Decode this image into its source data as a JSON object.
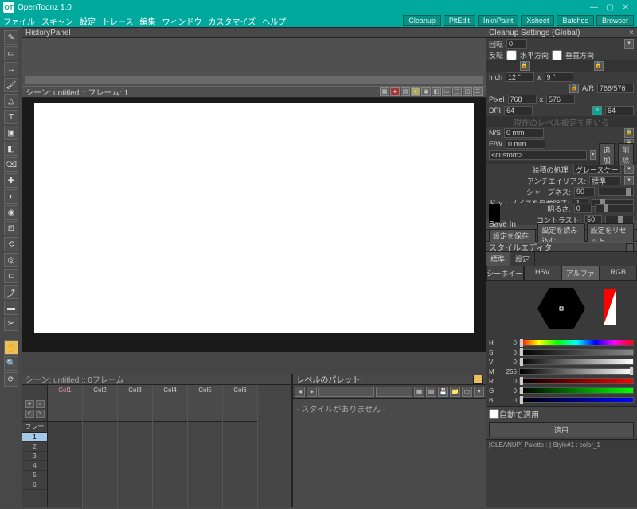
{
  "app": {
    "title": "OpenToonz 1.0",
    "logo": "OT"
  },
  "window_buttons": {
    "min": "—",
    "max": "▢",
    "close": "✕"
  },
  "menu": [
    "ファイル",
    "スキャン",
    "設定",
    "トレース",
    "編集",
    "ウィンドウ",
    "カスタマイズ",
    "ヘルプ"
  ],
  "modes": [
    "Cleanup",
    "PltEdit",
    "InknPaint",
    "Xsheet",
    "Batches",
    "Browser"
  ],
  "history_panel": {
    "title": "HistoryPanel"
  },
  "viewer": {
    "title": "シーン: untitled :: フレーム: 1"
  },
  "xsheet": {
    "title": "シーン: untitled   ::  0フレーム",
    "frame_label": "フレーム",
    "cols": [
      "Col1",
      "Col2",
      "Col3",
      "Col4",
      "Col5",
      "Col6"
    ],
    "frames": [
      "1",
      "2",
      "3",
      "4",
      "5",
      "6"
    ]
  },
  "palette": {
    "title": "レベルのパレット:",
    "empty_text": "- スタイルがありません -"
  },
  "cleanup": {
    "title": "Cleanup Settings (Global)",
    "rotation_label": "回転",
    "rotation_value": "0",
    "flip_label": "反転",
    "flip_h": "水平方向",
    "flip_v": "垂直方向",
    "inch_label": "Inch",
    "inch_w": "12 \"",
    "inch_h": "9 \"",
    "ar_label": "A/R",
    "ar_value": "768/576",
    "pixel_label": "Pixel",
    "pixel_w": "768",
    "pixel_h": "576",
    "dpi_label": "DPI",
    "dpi_value": "64",
    "dpi_value2": "64",
    "ns_label": "N/S",
    "ns_value": "0 mm",
    "ew_label": "E/W",
    "ew_value": "0 mm",
    "custom": "<custom>",
    "add": "追加",
    "remove": "削除",
    "line_label": "絵積の処理:",
    "line_value": "グレースケール",
    "anti_label": "アンチエイリアス:",
    "anti_value": "標準",
    "sharp_label": "シャープネス:",
    "sharp_value": "90",
    "dot_label": "ドットノイズを自動除去:",
    "dot_value": "2",
    "bright_label": "明るさ:",
    "bright_value": "0",
    "contrast_label": "コントラスト:",
    "contrast_value": "50",
    "savein_label": "Save In",
    "btn_save": "設定を保存",
    "btn_load": "設定を読み込む",
    "btn_reset": "設定をリセット"
  },
  "styleed": {
    "title": "スタイルエディタ",
    "tabs": [
      "標準",
      "設定"
    ],
    "modes": [
      "シーホイー",
      "HSV",
      "アルファ",
      "RGB"
    ],
    "channels": [
      {
        "l": "H",
        "v": "0"
      },
      {
        "l": "S",
        "v": "0"
      },
      {
        "l": "V",
        "v": "0"
      },
      {
        "l": "M",
        "v": "255"
      },
      {
        "l": "R",
        "v": "0"
      },
      {
        "l": "G",
        "v": "0"
      },
      {
        "l": "B",
        "v": "0"
      }
    ],
    "auto_label": "自動で適用",
    "apply": "適用",
    "status": "[CLEANUP]  Palette :  | Style#1 : color_1"
  },
  "chart_data": null
}
